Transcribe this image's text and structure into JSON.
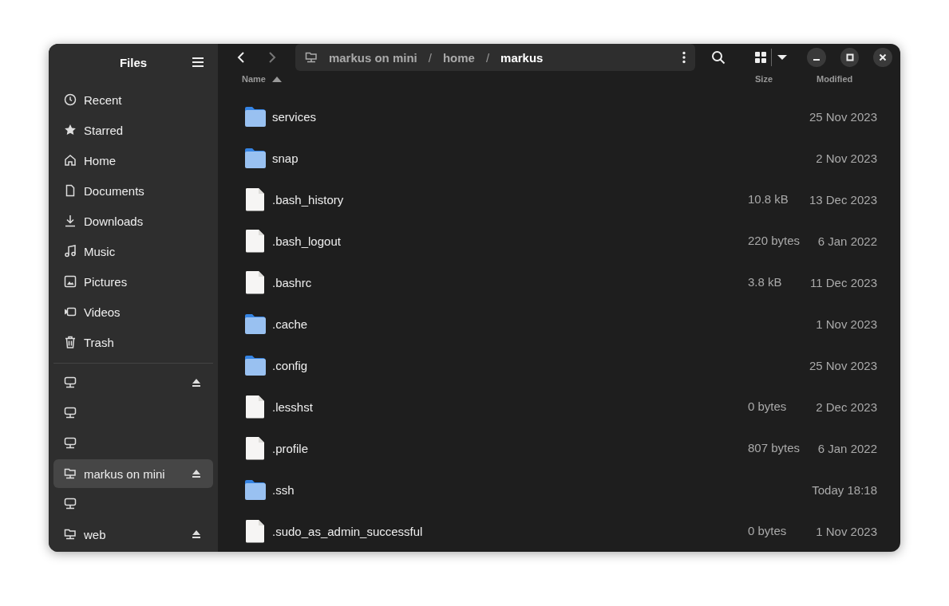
{
  "sidebar": {
    "title": "Files",
    "places": [
      {
        "kind": "recent",
        "label": "Recent"
      },
      {
        "kind": "starred",
        "label": "Starred"
      },
      {
        "kind": "home",
        "label": "Home"
      },
      {
        "kind": "documents",
        "label": "Documents"
      },
      {
        "kind": "downloads",
        "label": "Downloads"
      },
      {
        "kind": "music",
        "label": "Music"
      },
      {
        "kind": "pictures",
        "label": "Pictures"
      },
      {
        "kind": "videos",
        "label": "Videos"
      },
      {
        "kind": "trash",
        "label": "Trash"
      }
    ],
    "mounts": [
      {
        "kind": "server",
        "eject": true,
        "selected": false
      },
      {
        "kind": "server",
        "eject": false,
        "selected": false
      },
      {
        "kind": "server",
        "eject": false,
        "selected": false
      },
      {
        "kind": "share",
        "label": "markus on mini",
        "eject": true,
        "selected": true
      },
      {
        "kind": "server",
        "eject": false,
        "selected": false
      },
      {
        "kind": "share",
        "label": "web",
        "eject": true,
        "selected": false
      }
    ]
  },
  "path_bar": {
    "segments": [
      "markus on mini",
      "home",
      "markus"
    ],
    "separator": "/"
  },
  "table": {
    "columns": [
      {
        "label": "Name",
        "sorted": true
      },
      {
        "label": "Size",
        "sorted": false
      },
      {
        "label": "Modified",
        "sorted": false
      }
    ],
    "rows": [
      {
        "kind": "folder",
        "name": "services",
        "modified": "25 Nov 2023"
      },
      {
        "kind": "folder",
        "name": "snap",
        "modified": "2 Nov 2023"
      },
      {
        "kind": "file",
        "name": ".bash_history",
        "size": "10.8 kB",
        "modified": "13 Dec 2023"
      },
      {
        "kind": "file",
        "name": ".bash_logout",
        "size": "220 bytes",
        "modified": "6 Jan 2022"
      },
      {
        "kind": "file",
        "name": ".bashrc",
        "size": "3.8 kB",
        "modified": "11 Dec 2023"
      },
      {
        "kind": "folder",
        "name": ".cache",
        "modified": "1 Nov 2023"
      },
      {
        "kind": "folder",
        "name": ".config",
        "modified": "25 Nov 2023"
      },
      {
        "kind": "file",
        "name": ".lesshst",
        "size": "0 bytes",
        "modified": "2 Dec 2023"
      },
      {
        "kind": "file",
        "name": ".profile",
        "size": "807 bytes",
        "modified": "6 Jan 2022"
      },
      {
        "kind": "folder",
        "name": ".ssh",
        "modified": "Today 18:18"
      },
      {
        "kind": "file",
        "name": ".sudo_as_admin_successful",
        "size": "0 bytes",
        "modified": "1 Nov 2023"
      }
    ]
  }
}
